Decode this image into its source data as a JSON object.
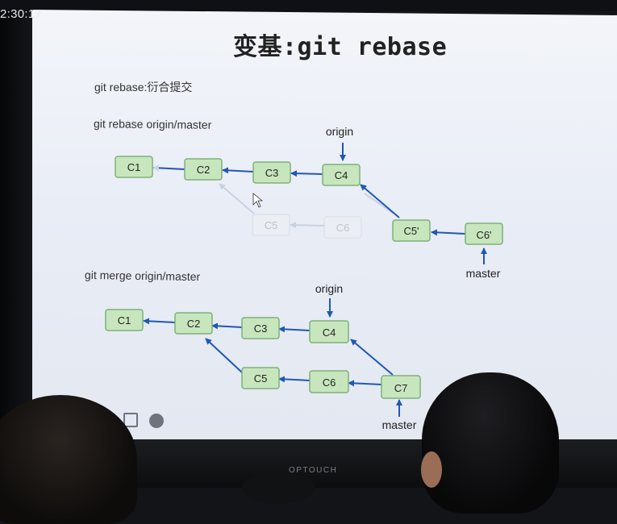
{
  "clock": "2:30:17",
  "slide": {
    "title": "变基:git rebase",
    "subtitle": "git rebase:衍合提交",
    "rebase_section": {
      "label": "git rebase origin/master",
      "pointers": {
        "origin": "origin",
        "master": "master"
      },
      "commits": [
        "C1",
        "C2",
        "C3",
        "C4",
        "C5",
        "C6",
        "C5'",
        "C6'"
      ]
    },
    "merge_section": {
      "label": "git merge origin/master",
      "pointers": {
        "origin": "origin",
        "master": "master"
      },
      "commits": [
        "C1",
        "C2",
        "C3",
        "C4",
        "C5",
        "C6",
        "C7"
      ]
    }
  },
  "projector_brand": "OPTOUCH",
  "colors": {
    "node_fill": "#c8e6be",
    "node_border": "#7fb079",
    "ghost_fill": "#eef1f4",
    "arrow": "#1f58b4",
    "ghost_arrow": "#c9d2e4"
  }
}
